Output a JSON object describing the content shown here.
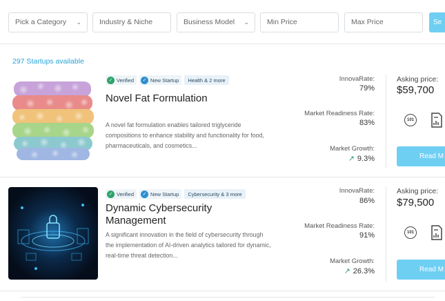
{
  "filters": {
    "category": "Pick a Category",
    "industry": "Industry & Niche",
    "business_model": "Business Model",
    "min_price": "Min Price",
    "max_price": "Max Price",
    "search_label": "Se"
  },
  "results_count": "297 Startups available",
  "startups": [
    {
      "badges": {
        "verified": "Verified",
        "new": "New Startup",
        "tag": "Health & 2 more"
      },
      "title": "Novel Fat Formulation",
      "description": "A novel fat formulation enables tailored triglyceride compositions to enhance stability and functionality for food, pharmaceuticals, and cosmetics...",
      "innovarate_label": "InnovaRate:",
      "innovarate": "79%",
      "readiness_label": "Market Readiness Rate:",
      "readiness": "83%",
      "growth_label": "Market Growth:",
      "growth": "9.3%",
      "asking_label": "Asking price:",
      "asking_price": "$59,700",
      "badge_icon_text": "101",
      "read_more": "Read M"
    },
    {
      "badges": {
        "verified": "Verified",
        "new": "New Startup",
        "tag": "Cybersecurity & 3 more"
      },
      "title": "Dynamic Cybersecurity Management",
      "description": "A significant innovation in the field of cybersecurity through the implementation of AI-driven analytics tailored for dynamic, real-time threat detection...",
      "innovarate_label": "InnovaRate:",
      "innovarate": "86%",
      "readiness_label": "Market Readiness Rate:",
      "readiness": "91%",
      "growth_label": "Market Growth:",
      "growth": "26.3%",
      "asking_label": "Asking price:",
      "asking_price": "$79,500",
      "badge_icon_text": "101",
      "read_more": "Read M"
    }
  ],
  "colors": {
    "accent": "#6fcff3",
    "link": "#29a3d6",
    "verified": "#2ea36c",
    "new_badge": "#2d8fd0",
    "growth": "#2ea36c"
  }
}
